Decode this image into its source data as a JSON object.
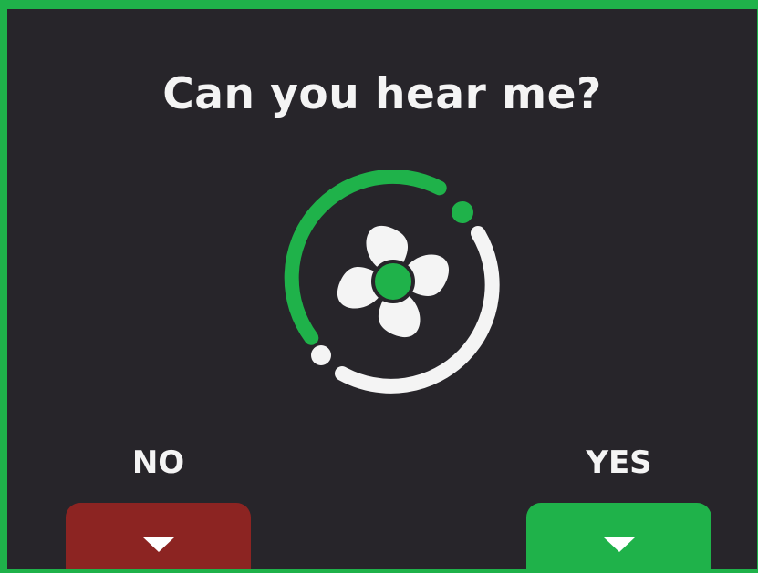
{
  "screen": {
    "title": "Can you hear me?"
  },
  "icons": {
    "center": "fan-icon",
    "no_button_icon": "triangle-down-icon",
    "yes_button_icon": "triangle-down-icon"
  },
  "options": {
    "no_label": "NO",
    "yes_label": "YES"
  },
  "colors": {
    "background": "#27252a",
    "accent_green": "#1fb24a",
    "no_red": "#8c2422",
    "foreground": "#f4f4f4"
  }
}
